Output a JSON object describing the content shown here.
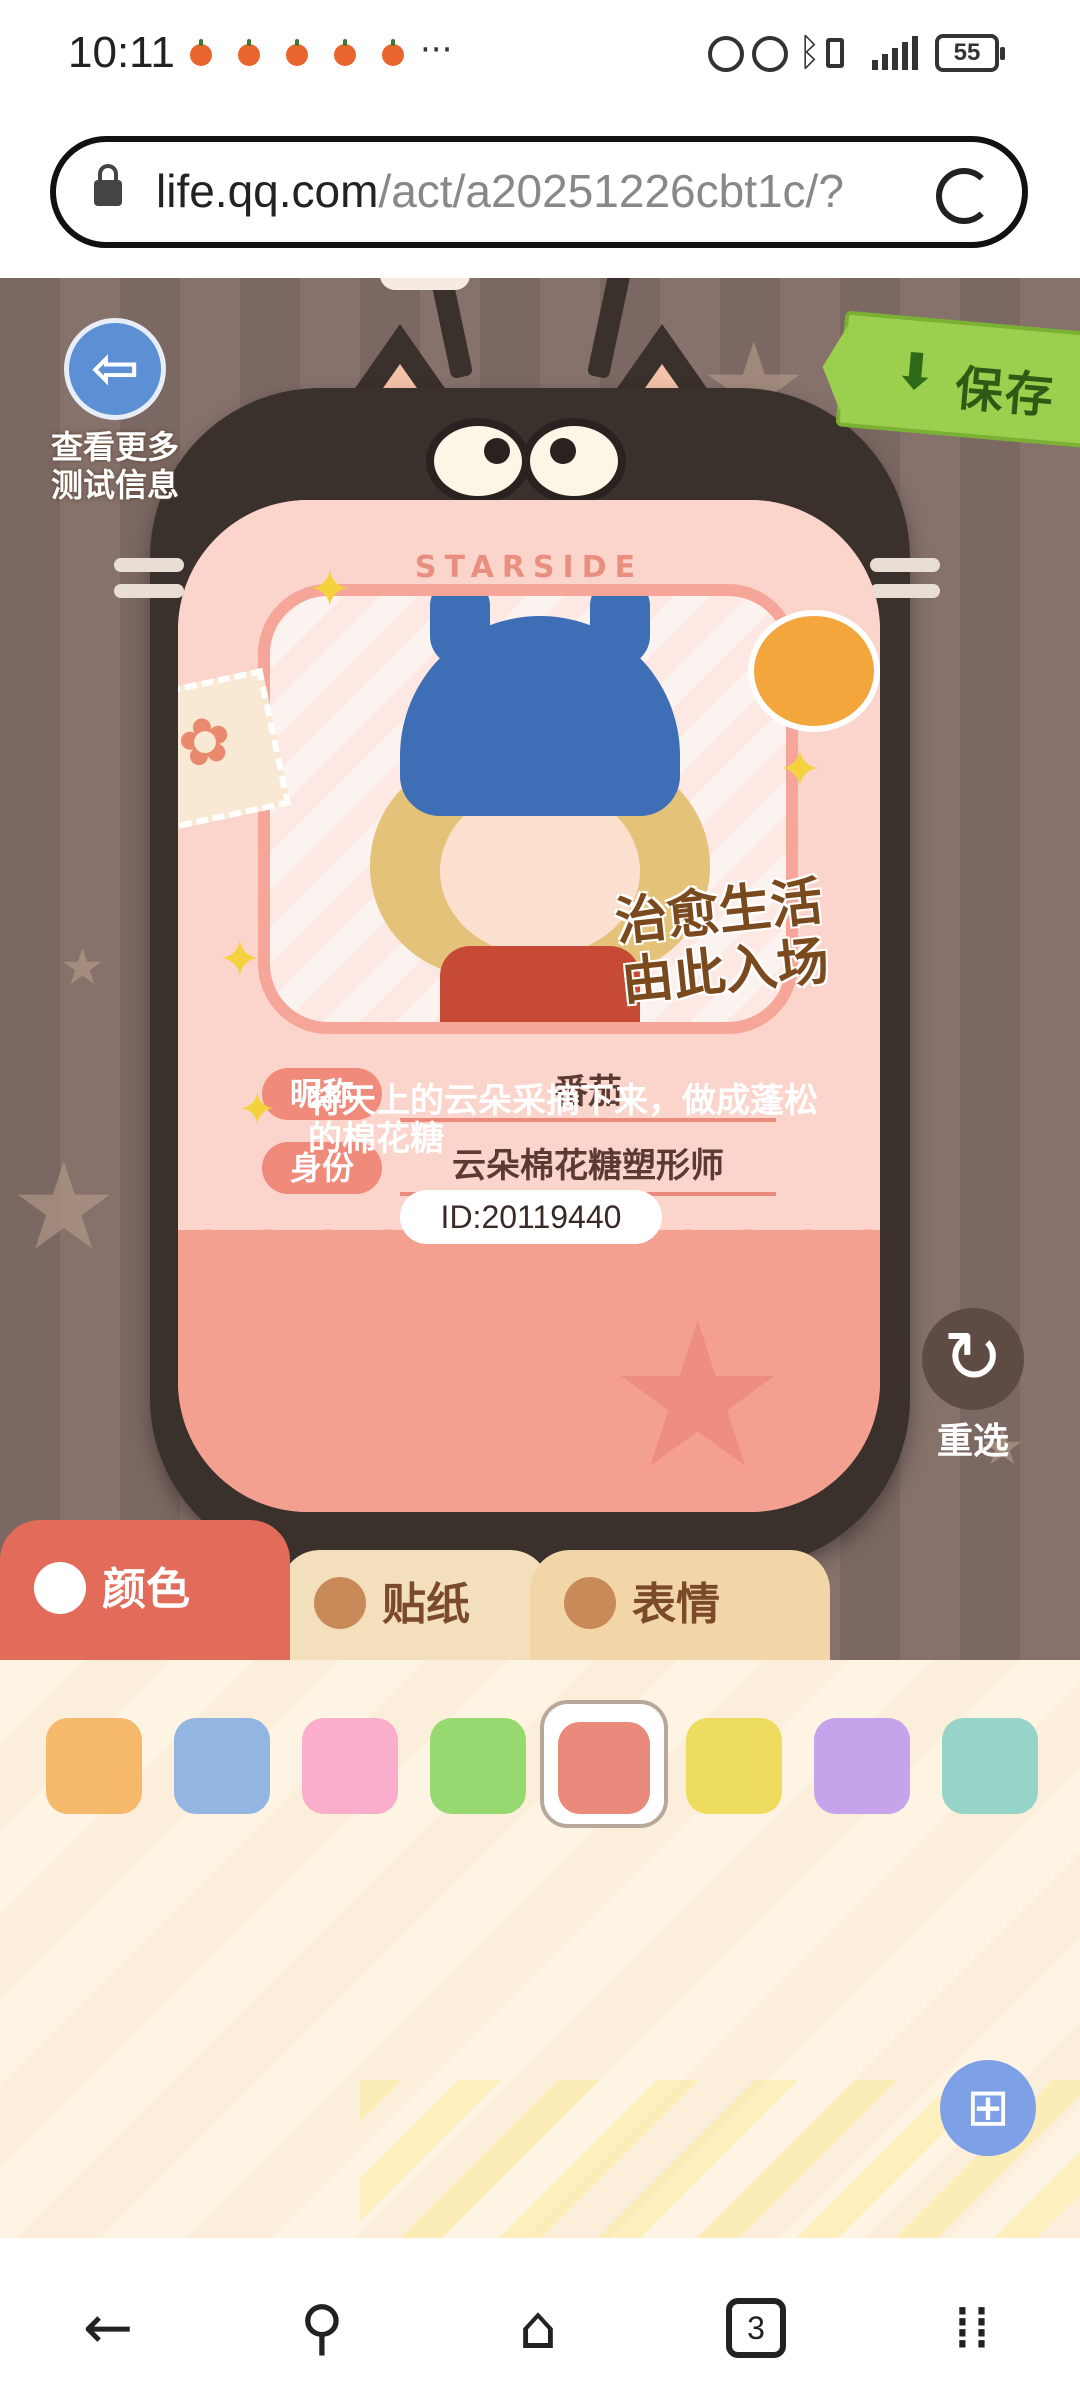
{
  "status_bar": {
    "time": "10:11",
    "more": "···",
    "battery": "55"
  },
  "browser": {
    "url_domain": "life.qq.com",
    "url_path": "/act/a20251226cbt1c/?",
    "open_tabs": "3"
  },
  "stage": {
    "back_label": "查看更多\n测试信息",
    "save_label": "保存",
    "reroll_label": "重选"
  },
  "card": {
    "brand": "STARSIDE",
    "slogan_line1": "治愈生活",
    "slogan_line2": "由此入场",
    "nickname_label": "昵称",
    "nickname_value": "番茄",
    "identity_label": "身份",
    "identity_value": "云朵棉花糖塑形师",
    "description": "将天上的云朵采摘下来，做成蓬松的棉花糖",
    "id": "ID:20119440"
  },
  "tabs": [
    {
      "label": "颜色",
      "selected": true
    },
    {
      "label": "贴纸",
      "selected": false
    },
    {
      "label": "表情",
      "selected": false
    }
  ],
  "palette": {
    "colors": [
      "#f6b86a",
      "#93b5e2",
      "#fbaecb",
      "#98d870",
      "#e98a7c",
      "#eedc5e",
      "#c7a3ec",
      "#96d3c8"
    ],
    "selected_index": 4
  },
  "colors": {
    "accent_tab": "#e36b59",
    "card": "#f4a89b",
    "frame": "#3a302c"
  }
}
